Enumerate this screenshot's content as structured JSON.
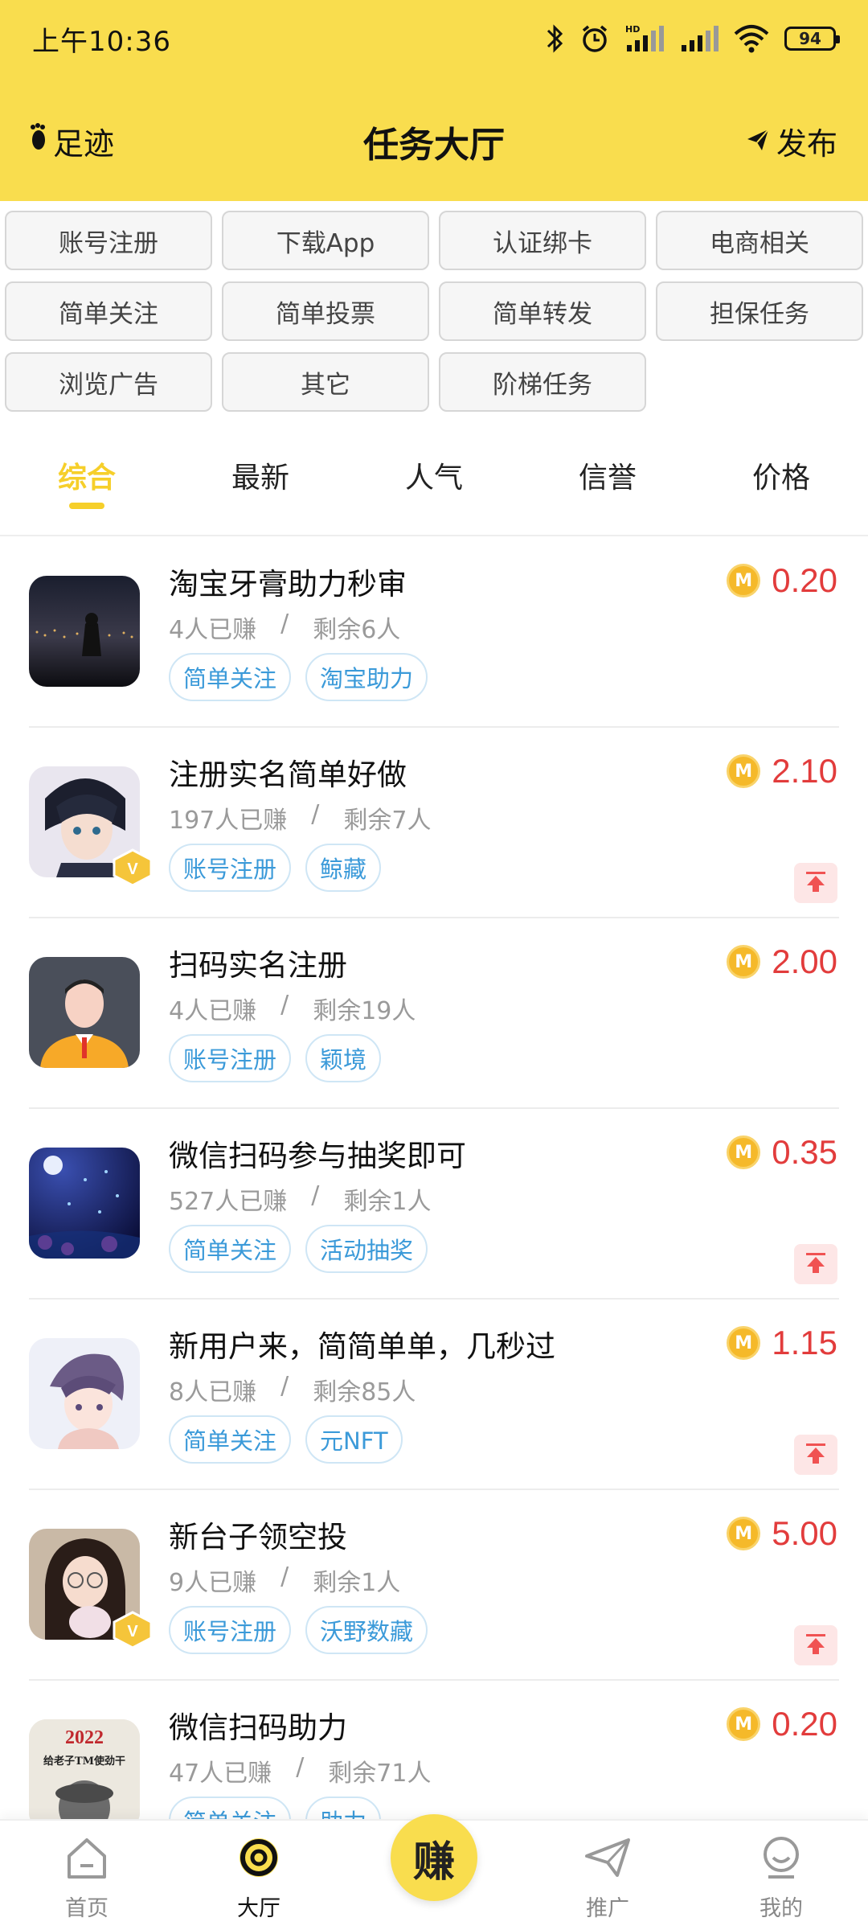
{
  "status_bar": {
    "time": "上午10:36",
    "battery": "94"
  },
  "header": {
    "left_label": "足迹",
    "title": "任务大厅",
    "right_label": "发布",
    "bg_color": "#f9dd4e"
  },
  "categories": [
    "账号注册",
    "下载App",
    "认证绑卡",
    "电商相关",
    "简单关注",
    "简单投票",
    "简单转发",
    "担保任务",
    "浏览广告",
    "其它",
    "阶梯任务"
  ],
  "sort_tabs": [
    {
      "label": "综合",
      "active": true
    },
    {
      "label": "最新",
      "active": false
    },
    {
      "label": "人气",
      "active": false
    },
    {
      "label": "信誉",
      "active": false
    },
    {
      "label": "价格",
      "active": false
    }
  ],
  "tasks": [
    {
      "title": "淘宝牙膏助力秒审",
      "earned": "4人已赚",
      "remaining": "剩余6人",
      "tags": [
        "简单关注",
        "淘宝助力"
      ],
      "price": "0.20",
      "vip": false,
      "pinned": false,
      "avatar": "night-city-photo"
    },
    {
      "title": "注册实名简单好做",
      "earned": "197人已赚",
      "remaining": "剩余7人",
      "tags": [
        "账号注册",
        "鲸藏"
      ],
      "price": "2.10",
      "vip": true,
      "pinned": true,
      "avatar": "anime-boy-photo"
    },
    {
      "title": "扫码实名注册",
      "earned": "4人已赚",
      "remaining": "剩余19人",
      "tags": [
        "账号注册",
        "颖境"
      ],
      "price": "2.00",
      "vip": false,
      "pinned": false,
      "avatar": "default-man-avatar"
    },
    {
      "title": "微信扫码参与抽奖即可",
      "earned": "527人已赚",
      "remaining": "剩余1人",
      "tags": [
        "简单关注",
        "活动抽奖"
      ],
      "price": "0.35",
      "vip": false,
      "pinned": true,
      "avatar": "night-flowers-photo"
    },
    {
      "title": "新用户来，简简单单，几秒过",
      "earned": "8人已赚",
      "remaining": "剩余85人",
      "tags": [
        "简单关注",
        "元NFT"
      ],
      "price": "1.15",
      "vip": false,
      "pinned": true,
      "avatar": "anime-man-photo"
    },
    {
      "title": "新台子领空投",
      "earned": "9人已赚",
      "remaining": "剩余1人",
      "tags": [
        "账号注册",
        "沃野数藏"
      ],
      "price": "5.00",
      "vip": true,
      "pinned": true,
      "avatar": "girl-photo"
    },
    {
      "title": "微信扫码助力",
      "earned": "47人已赚",
      "remaining": "剩余71人",
      "tags": [
        "简单关注",
        "助力"
      ],
      "price": "0.20",
      "vip": false,
      "pinned": false,
      "avatar": "poster-2022",
      "avatar_text": "2022",
      "avatar_subtext": "给老子TM使劲干"
    }
  ],
  "bottom_nav": [
    {
      "label": "首页",
      "icon": "home-icon",
      "active": false
    },
    {
      "label": "大厅",
      "icon": "hall-icon",
      "active": true
    },
    {
      "label": "赚",
      "icon": "earn-button",
      "active": false
    },
    {
      "label": "推广",
      "icon": "paper-plane-icon",
      "active": false
    },
    {
      "label": "我的",
      "icon": "profile-icon",
      "active": false
    }
  ],
  "colors": {
    "accent_yellow": "#f6cf2a",
    "price_red": "#e23c3c",
    "tag_blue": "#3b9ad9"
  }
}
